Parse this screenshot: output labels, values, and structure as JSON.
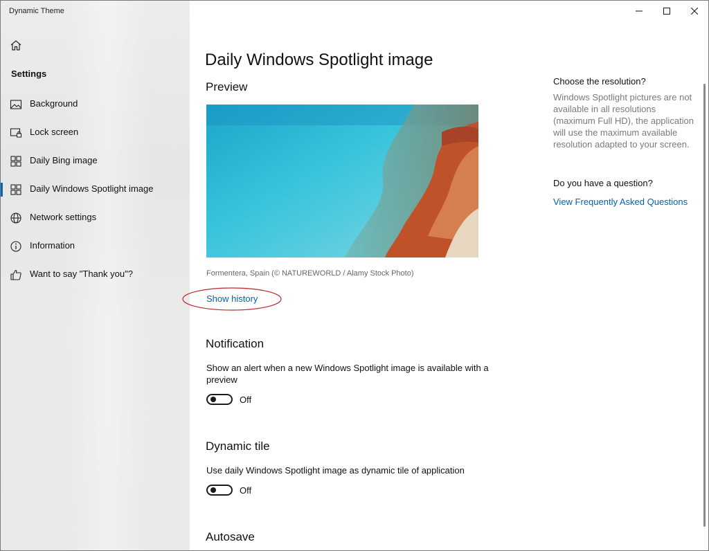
{
  "app_title": "Dynamic Theme",
  "sidebar": {
    "section_title": "Settings",
    "items": [
      {
        "label": "Background",
        "icon": "image-icon"
      },
      {
        "label": "Lock screen",
        "icon": "lock-screen-icon"
      },
      {
        "label": "Daily Bing image",
        "icon": "daily-image-icon"
      },
      {
        "label": "Daily Windows Spotlight image",
        "icon": "daily-image-icon",
        "selected": true
      },
      {
        "label": "Network settings",
        "icon": "globe-icon"
      },
      {
        "label": "Information",
        "icon": "info-icon"
      },
      {
        "label": "Want to say \"Thank you\"?",
        "icon": "thumbs-up-icon"
      }
    ]
  },
  "main": {
    "title": "Daily Windows Spotlight image",
    "preview_heading": "Preview",
    "image_caption": "Formentera, Spain (© NATUREWORLD / Alamy Stock Photo)",
    "show_history": "Show history",
    "notification": {
      "heading": "Notification",
      "description": "Show an alert when a new Windows Spotlight image is available with a preview",
      "toggle_label": "Off",
      "toggle_on": false
    },
    "dynamic_tile": {
      "heading": "Dynamic tile",
      "description": "Use daily Windows Spotlight image as dynamic tile of application",
      "toggle_label": "Off",
      "toggle_on": false
    },
    "autosave_heading": "Autosave"
  },
  "right_panel": {
    "resolution_heading": "Choose the resolution?",
    "resolution_text": "Windows Spotlight pictures are not available in all resolutions (maximum Full HD), the application will use the maximum available resolution adapted to your screen.",
    "question_heading": "Do you have a question?",
    "faq_link": "View Frequently Asked Questions"
  },
  "colors": {
    "accent": "#0063b1",
    "annotation": "#c0262c"
  }
}
